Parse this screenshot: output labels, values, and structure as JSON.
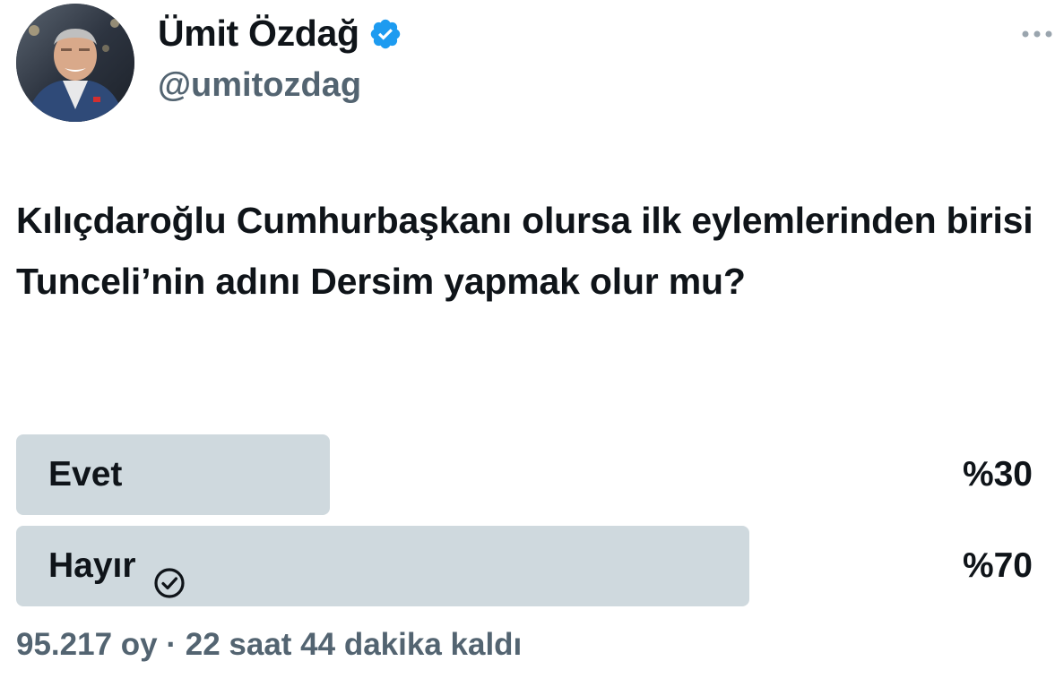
{
  "author": {
    "name": "Ümit Özdağ",
    "handle": "@umitozdag",
    "verified": true,
    "avatar_icon": "avatar-photo",
    "verified_icon": "verified-badge-icon",
    "verified_color": "#1d9bf0"
  },
  "more_icon": "more-horizontal-icon",
  "tweet": {
    "text": "Kılıçdaroğlu Cumhurbaşkanı olursa ilk eylemlerinden birisi Tunceli’nin adını Dersim yapmak olur mu?"
  },
  "poll": {
    "options": [
      {
        "label": "Evet",
        "percent_label": "%30",
        "percent": 30,
        "winner": false
      },
      {
        "label": "Hayır",
        "percent_label": "%70",
        "percent": 70,
        "winner": true
      }
    ],
    "votes": "95.217 oy",
    "separator": "·",
    "time_left": "22 saat 44 dakika kaldı",
    "bar_color": "#cfd9de"
  },
  "colors": {
    "text_primary": "#0f1419",
    "text_secondary": "#536471"
  }
}
